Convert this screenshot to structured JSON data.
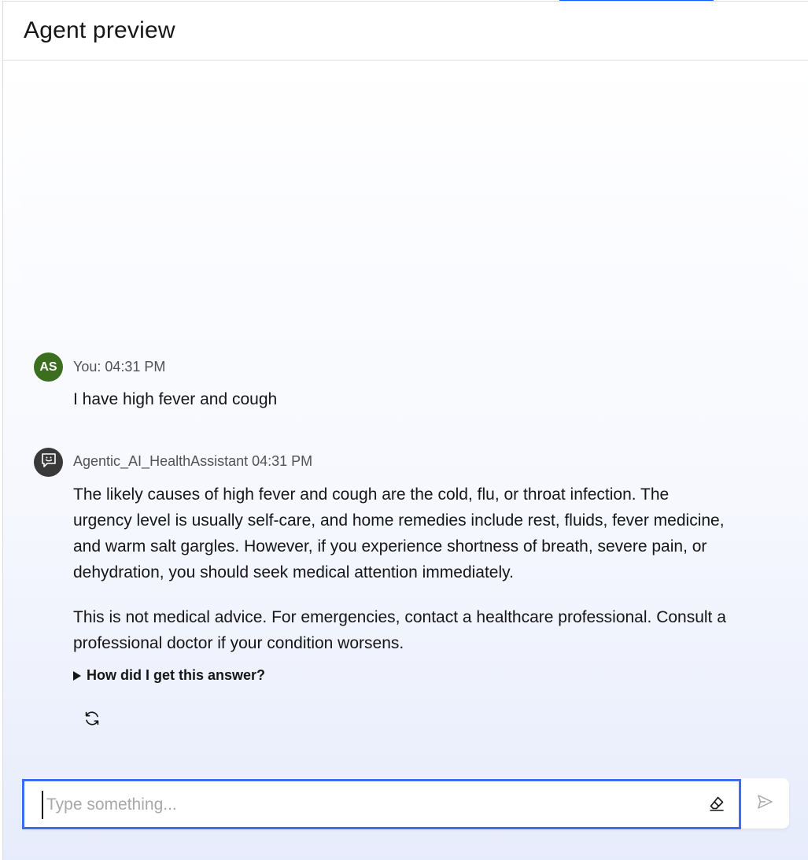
{
  "header": {
    "title": "Agent preview"
  },
  "messages": {
    "user": {
      "avatar_initials": "AS",
      "meta": "You: 04:31 PM",
      "text": "I have high fever and cough",
      "avatar_color": "#3c6e1f"
    },
    "agent": {
      "avatar_icon": "chat-bot-icon",
      "meta": "Agentic_AI_HealthAssistant 04:31 PM",
      "paragraph_1": "The likely causes of high fever and cough are the cold, flu, or throat infection. The urgency level is usually self-care, and home remedies include rest, fluids, fever medicine, and warm salt gargles. However, if you experience shortness of breath, severe pain, or dehydration, you should seek medical attention immediately.",
      "paragraph_2": "This is not medical advice. For emergencies, contact a healthcare professional. Consult a professional doctor if your condition worsens.",
      "explain_toggle_label": "How did I get this answer?",
      "regenerate_icon": "refresh-icon"
    }
  },
  "composer": {
    "placeholder": "Type something...",
    "value": "",
    "clear_icon": "eraser-icon",
    "send_icon": "send-icon",
    "focus_color": "#3a6ef2"
  },
  "colors": {
    "accent": "#0f62fe"
  }
}
